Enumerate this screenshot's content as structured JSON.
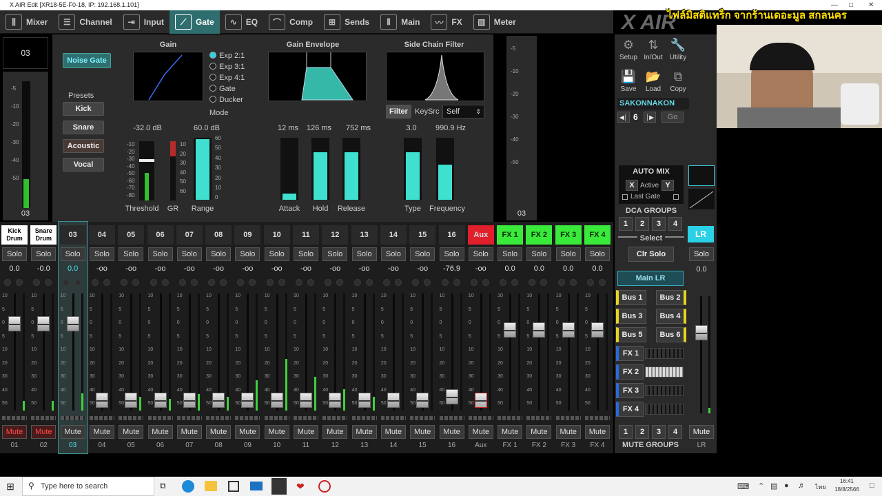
{
  "window": {
    "title": "X AIR Edit [XR18-5E-F0-18, IP: 192.168.1.101]"
  },
  "tabs": [
    {
      "label": "Mixer",
      "icon": "mixer-icon"
    },
    {
      "label": "Channel",
      "icon": "channel-icon"
    },
    {
      "label": "Input",
      "icon": "input-icon"
    },
    {
      "label": "Gate",
      "icon": "gate-icon"
    },
    {
      "label": "EQ",
      "icon": "eq-icon"
    },
    {
      "label": "Comp",
      "icon": "comp-icon"
    },
    {
      "label": "Sends",
      "icon": "sends-icon"
    },
    {
      "label": "Main",
      "icon": "main-icon"
    },
    {
      "label": "FX",
      "icon": "fx-icon"
    },
    {
      "label": "Meter",
      "icon": "meter-icon"
    }
  ],
  "channel_display": {
    "number": "03",
    "meter_label": "03"
  },
  "meter_scale": [
    "-5",
    "-10",
    "-20",
    "-30",
    "-40",
    "-50"
  ],
  "gate": {
    "noise_gate_label": "Noise Gate",
    "presets": {
      "title": "Presets",
      "items": [
        "Kick",
        "Snare",
        "Acoustic",
        "Vocal"
      ]
    },
    "gain_title": "Gain",
    "modes": [
      "Exp 2:1",
      "Exp 3:1",
      "Exp 4:1",
      "Gate",
      "Ducker"
    ],
    "mode_selected": "Exp 2:1",
    "mode_label": "Mode",
    "envelope_title": "Gain Envelope",
    "sidechain_title": "Side Chain Filter",
    "filter_label": "Filter",
    "keysrc_label": "KeySrc",
    "keysrc_value": "Self",
    "threshold": {
      "value": "-32.0 dB",
      "label": "Threshold",
      "scale": [
        "-10",
        "-20",
        "-30",
        "-40",
        "-50",
        "-60",
        "-70",
        "-80"
      ]
    },
    "gr": {
      "label": "GR",
      "scale": [
        "10",
        "20",
        "30",
        "40",
        "50",
        "60"
      ]
    },
    "range": {
      "value": "60.0 dB",
      "label": "Range",
      "scale": [
        "60",
        "50",
        "40",
        "30",
        "20",
        "10",
        "0"
      ],
      "level": 1.0
    },
    "attack": {
      "value": "12 ms",
      "label": "Attack",
      "level": 0.1
    },
    "hold": {
      "value": "126 ms",
      "label": "Hold",
      "level": 0.78
    },
    "release": {
      "value": "752 ms",
      "label": "Release",
      "level": 0.78
    },
    "type": {
      "value": "3.0",
      "label": "Type",
      "level": 0.78
    },
    "frequency": {
      "value": "990.9 Hz",
      "label": "Frequency",
      "level": 0.58
    }
  },
  "strips": [
    {
      "name": "Kick Drum",
      "solo": "Solo",
      "gain": "0.0",
      "mute": "Mute",
      "muted": true,
      "num": "01",
      "fader": 0.74,
      "meter": 0.08,
      "color": "#ffffff"
    },
    {
      "name": "Snare Drum",
      "solo": "Solo",
      "gain": "-0.0",
      "mute": "Mute",
      "muted": true,
      "num": "02",
      "fader": 0.74,
      "meter": 0.08,
      "color": "#ffffff"
    },
    {
      "name": "03",
      "solo": "Solo",
      "gain": "0.0",
      "mute": "Mute",
      "muted": false,
      "num": "03",
      "fader": 0.74,
      "meter": 0.15,
      "color": "#2a2a2a",
      "selected": true
    },
    {
      "name": "04",
      "solo": "Solo",
      "gain": "-oo",
      "mute": "Mute",
      "muted": false,
      "num": "04",
      "fader": 0.09,
      "meter": 0.0,
      "color": "#2a2a2a"
    },
    {
      "name": "05",
      "solo": "Solo",
      "gain": "-oo",
      "mute": "Mute",
      "muted": false,
      "num": "05",
      "fader": 0.09,
      "meter": 0.12,
      "color": "#2a2a2a"
    },
    {
      "name": "06",
      "solo": "Solo",
      "gain": "-oo",
      "mute": "Mute",
      "muted": false,
      "num": "06",
      "fader": 0.09,
      "meter": 0.1,
      "color": "#2a2a2a"
    },
    {
      "name": "07",
      "solo": "Solo",
      "gain": "-oo",
      "mute": "Mute",
      "muted": false,
      "num": "07",
      "fader": 0.09,
      "meter": 0.14,
      "color": "#2a2a2a"
    },
    {
      "name": "08",
      "solo": "Solo",
      "gain": "-oo",
      "mute": "Mute",
      "muted": false,
      "num": "08",
      "fader": 0.09,
      "meter": 0.12,
      "color": "#2a2a2a"
    },
    {
      "name": "09",
      "solo": "Solo",
      "gain": "-oo",
      "mute": "Mute",
      "muted": false,
      "num": "09",
      "fader": 0.09,
      "meter": 0.26,
      "color": "#2a2a2a"
    },
    {
      "name": "10",
      "solo": "Solo",
      "gain": "-oo",
      "mute": "Mute",
      "muted": false,
      "num": "10",
      "fader": 0.09,
      "meter": 0.44,
      "color": "#2a2a2a"
    },
    {
      "name": "11",
      "solo": "Solo",
      "gain": "-oo",
      "mute": "Mute",
      "muted": false,
      "num": "11",
      "fader": 0.09,
      "meter": 0.29,
      "color": "#2a2a2a"
    },
    {
      "name": "12",
      "solo": "Solo",
      "gain": "-oo",
      "mute": "Mute",
      "muted": false,
      "num": "12",
      "fader": 0.09,
      "meter": 0.18,
      "color": "#2a2a2a"
    },
    {
      "name": "13",
      "solo": "Solo",
      "gain": "-oo",
      "mute": "Mute",
      "muted": false,
      "num": "13",
      "fader": 0.09,
      "meter": 0.12,
      "color": "#2a2a2a"
    },
    {
      "name": "14",
      "solo": "Solo",
      "gain": "-oo",
      "mute": "Mute",
      "muted": false,
      "num": "14",
      "fader": 0.09,
      "meter": 0.0,
      "color": "#2a2a2a"
    },
    {
      "name": "15",
      "solo": "Solo",
      "gain": "-oo",
      "mute": "Mute",
      "muted": false,
      "num": "15",
      "fader": 0.09,
      "meter": 0.0,
      "color": "#2a2a2a"
    },
    {
      "name": "16",
      "solo": "Solo",
      "gain": "-76.9",
      "mute": "Mute",
      "muted": false,
      "num": "16",
      "fader": 0.12,
      "meter": 0.0,
      "color": "#2a2a2a"
    },
    {
      "name": "Aux",
      "solo": "Solo",
      "gain": "-oo",
      "mute": "Mute",
      "muted": false,
      "num": "Aux",
      "fader": 0.09,
      "meter": 0.0,
      "color": "#e0202a"
    },
    {
      "name": "FX 1",
      "solo": "Solo",
      "gain": "0.0",
      "mute": "Mute",
      "muted": false,
      "num": "FX 1",
      "fader": 0.69,
      "meter": 0.0,
      "color": "#3aea3a"
    },
    {
      "name": "FX 2",
      "solo": "Solo",
      "gain": "0.0",
      "mute": "Mute",
      "muted": false,
      "num": "FX 2",
      "fader": 0.69,
      "meter": 0.0,
      "color": "#3aea3a"
    },
    {
      "name": "FX 3",
      "solo": "Solo",
      "gain": "0.0",
      "mute": "Mute",
      "muted": false,
      "num": "FX 3",
      "fader": 0.69,
      "meter": 0.0,
      "color": "#3aea3a"
    },
    {
      "name": "FX 4",
      "solo": "Solo",
      "gain": "0.0",
      "mute": "Mute",
      "muted": false,
      "num": "FX 4",
      "fader": 0.69,
      "meter": 0.0,
      "color": "#3aea3a"
    }
  ],
  "fader_scale": [
    "10",
    "5",
    "0",
    "5",
    "10",
    "20",
    "30",
    "40",
    "50"
  ],
  "right": {
    "toolbar": [
      "Setup",
      "In/Out",
      "Utility",
      "Save",
      "Load",
      "Copy"
    ],
    "scene_name": "SAKONNAKON",
    "scene_number": "6",
    "go_label": "Go",
    "automix": {
      "title": "AUTO MIX",
      "x": "X",
      "active": "Active",
      "y": "Y",
      "last_gate": "Last Gate"
    },
    "dca": {
      "title": "DCA GROUPS",
      "buttons": [
        "1",
        "2",
        "3",
        "4"
      ],
      "select": "Select",
      "clr_solo": "Clr Solo"
    },
    "main_lr": "Main LR",
    "buses": [
      "Bus 1",
      "Bus 2",
      "Bus 3",
      "Bus 4",
      "Bus 5",
      "Bus 6"
    ],
    "fx": [
      "FX 1",
      "FX 2",
      "FX 3",
      "FX 4"
    ],
    "mute_groups": {
      "title": "MUTE GROUPS",
      "buttons": [
        "1",
        "2",
        "3",
        "4"
      ]
    },
    "lr": {
      "label": "LR",
      "solo": "Solo",
      "gain": "0.0",
      "mute": "Mute",
      "num": "LR",
      "fader": 0.69
    }
  },
  "overlay_text": "ไฟล์มิสติแทร็ก จากร้านเดอะมูล สกลนคร",
  "overlay_brand": "X AIR",
  "taskbar": {
    "search_placeholder": "Type here to search",
    "time": "16:41",
    "date": "18/8/2566",
    "lang": "ไทย"
  }
}
